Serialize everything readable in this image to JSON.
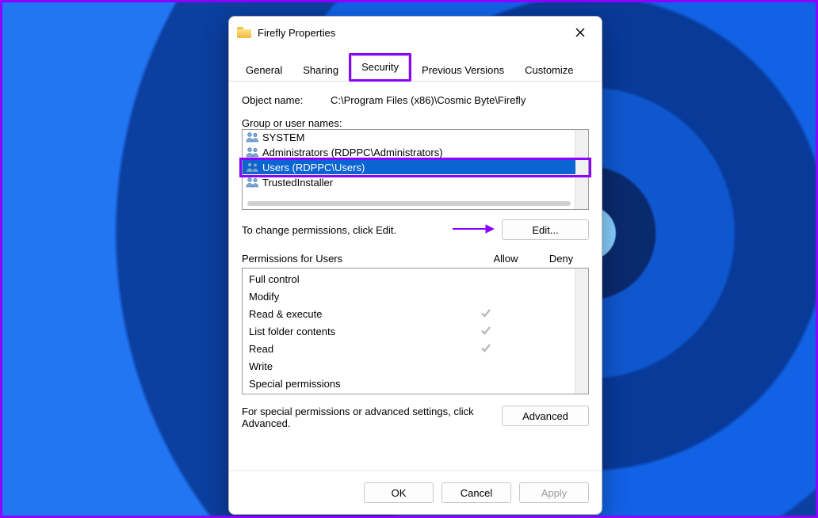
{
  "window": {
    "title": "Firefly Properties"
  },
  "tabs": {
    "general": "General",
    "sharing": "Sharing",
    "security": "Security",
    "previous": "Previous Versions",
    "customize": "Customize"
  },
  "object": {
    "label": "Object name:",
    "value": "C:\\Program Files (x86)\\Cosmic Byte\\Firefly"
  },
  "groups": {
    "label": "Group or user names:",
    "items": [
      {
        "name": "SYSTEM"
      },
      {
        "name": "Administrators (RDPPC\\Administrators)"
      },
      {
        "name": "Users (RDPPC\\Users)",
        "selected": true
      },
      {
        "name": "TrustedInstaller"
      }
    ]
  },
  "editHint": "To change permissions, click Edit.",
  "editBtn": "Edit...",
  "permHeader": {
    "title": "Permissions for Users",
    "allow": "Allow",
    "deny": "Deny"
  },
  "perms": [
    {
      "name": "Full control",
      "allow": false,
      "deny": false
    },
    {
      "name": "Modify",
      "allow": false,
      "deny": false
    },
    {
      "name": "Read & execute",
      "allow": true,
      "deny": false
    },
    {
      "name": "List folder contents",
      "allow": true,
      "deny": false
    },
    {
      "name": "Read",
      "allow": true,
      "deny": false
    },
    {
      "name": "Write",
      "allow": false,
      "deny": false
    },
    {
      "name": "Special permissions",
      "allow": false,
      "deny": false
    }
  ],
  "advHint": "For special permissions or advanced settings, click Advanced.",
  "advBtn": "Advanced",
  "footer": {
    "ok": "OK",
    "cancel": "Cancel",
    "apply": "Apply"
  }
}
